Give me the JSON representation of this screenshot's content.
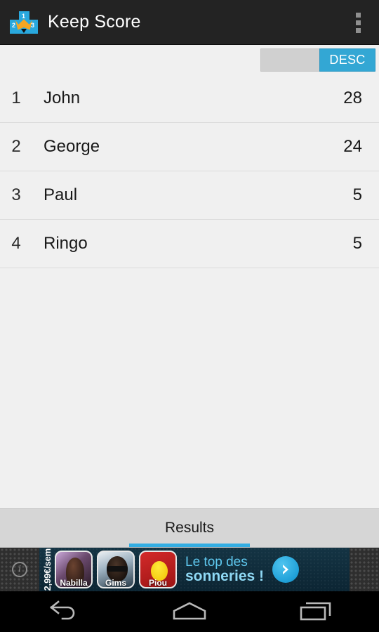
{
  "actionbar": {
    "title": "Keep Score",
    "icon_name": "podium-app-icon",
    "podium_labels": {
      "first": "1",
      "second": "2",
      "third": "3"
    },
    "overflow_label": "More options"
  },
  "sort_toggle": {
    "asc_label": "",
    "desc_label": "DESC",
    "selected": "DESC",
    "accent_color": "#33a7d4"
  },
  "scoreboard": {
    "rows": [
      {
        "rank": "1",
        "name": "John",
        "score": "28"
      },
      {
        "rank": "2",
        "name": "George",
        "score": "24"
      },
      {
        "rank": "3",
        "name": "Paul",
        "score": "5"
      },
      {
        "rank": "4",
        "name": "Ringo",
        "score": "5"
      }
    ]
  },
  "tabs": {
    "items": [
      {
        "label": "Results",
        "selected": true
      }
    ],
    "indicator_color": "#33aee3"
  },
  "ad": {
    "price": "2,99€/sem",
    "info_glyph": "i",
    "thumbnails": [
      {
        "caption": "Nabilla"
      },
      {
        "caption": "Gims"
      },
      {
        "caption": "Piou"
      }
    ],
    "headline_line1": "Le top des",
    "headline_line2": "sonneries !",
    "cta_icon": "chevron-right-icon"
  },
  "navbar": {
    "back_label": "Back",
    "home_label": "Home",
    "recents_label": "Recent apps"
  }
}
